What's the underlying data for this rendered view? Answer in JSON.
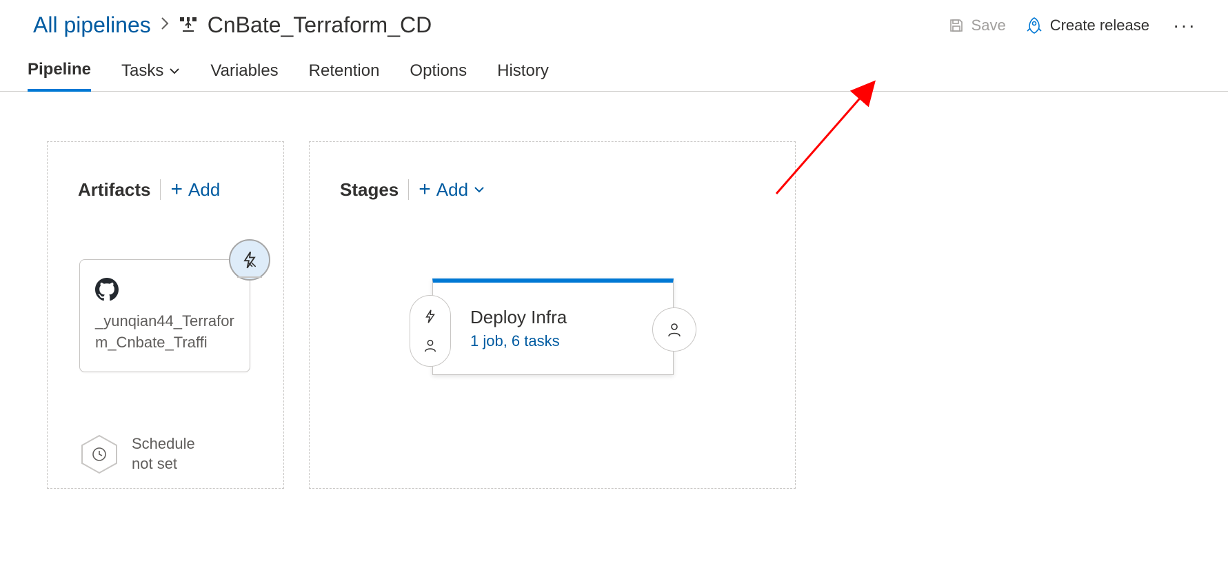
{
  "breadcrumb": {
    "parent": "All pipelines"
  },
  "pipeline": {
    "name": "CnBate_Terraform_CD"
  },
  "actions": {
    "save": "Save",
    "create_release": "Create release"
  },
  "tabs": {
    "pipeline": "Pipeline",
    "tasks": "Tasks",
    "variables": "Variables",
    "retention": "Retention",
    "options": "Options",
    "history": "History"
  },
  "artifacts": {
    "title": "Artifacts",
    "add": "Add",
    "card": {
      "name": "_yunqian44_Terraform_Cnbate_Traffi"
    },
    "schedule_line1": "Schedule",
    "schedule_line2": "not set"
  },
  "stages": {
    "title": "Stages",
    "add": "Add",
    "card": {
      "name": "Deploy Infra",
      "summary": "1 job, 6 tasks"
    }
  }
}
